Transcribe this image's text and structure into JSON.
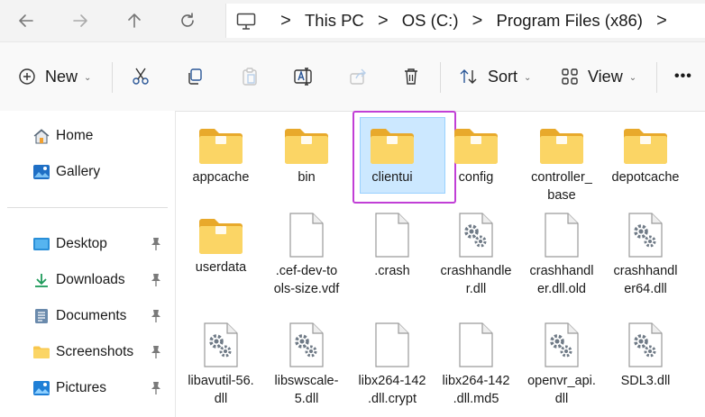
{
  "address": {
    "crumbs": [
      "This PC",
      "OS (C:)",
      "Program Files (x86)"
    ],
    "separator": ">"
  },
  "icons": {
    "back": "arrow-left-icon",
    "forward": "arrow-right-icon",
    "up": "arrow-up-icon",
    "refresh": "refresh-icon",
    "computer": "monitor-icon"
  },
  "toolbar": {
    "new_label": "New",
    "sort_label": "Sort",
    "view_label": "View",
    "more_label": "•••"
  },
  "sidebar": {
    "items": [
      {
        "label": "Home",
        "icon": "home-icon",
        "pinned": false
      },
      {
        "label": "Gallery",
        "icon": "gallery-icon",
        "pinned": false
      },
      {
        "label": "Desktop",
        "icon": "desktop-icon",
        "pinned": true
      },
      {
        "label": "Downloads",
        "icon": "download-icon",
        "pinned": true
      },
      {
        "label": "Documents",
        "icon": "documents-icon",
        "pinned": true
      },
      {
        "label": "Screenshots",
        "icon": "folder-icon",
        "pinned": true
      },
      {
        "label": "Pictures",
        "icon": "pictures-icon",
        "pinned": true
      }
    ]
  },
  "files": [
    {
      "lines": [
        "appcache"
      ],
      "type": "folder"
    },
    {
      "lines": [
        "bin"
      ],
      "type": "folder"
    },
    {
      "lines": [
        "clientui"
      ],
      "type": "folder",
      "selected": true
    },
    {
      "lines": [
        "config"
      ],
      "type": "folder"
    },
    {
      "lines": [
        "controller_",
        "base"
      ],
      "type": "folder"
    },
    {
      "lines": [
        "depotcache"
      ],
      "type": "folder"
    },
    {
      "lines": [
        "userdata"
      ],
      "type": "folder"
    },
    {
      "lines": [
        ".cef-dev-to",
        "ols-size.vdf"
      ],
      "type": "file"
    },
    {
      "lines": [
        ".crash"
      ],
      "type": "file"
    },
    {
      "lines": [
        "crashhandle",
        "r.dll"
      ],
      "type": "dll"
    },
    {
      "lines": [
        "crashhandl",
        "er.dll.old"
      ],
      "type": "file"
    },
    {
      "lines": [
        "crashhandl",
        "er64.dll"
      ],
      "type": "dll"
    },
    {
      "lines": [
        "libavutil-56.",
        "dll"
      ],
      "type": "dll"
    },
    {
      "lines": [
        "libswscale-",
        "5.dll"
      ],
      "type": "dll"
    },
    {
      "lines": [
        "libx264-142",
        ".dll.crypt"
      ],
      "type": "file"
    },
    {
      "lines": [
        "libx264-142",
        ".dll.md5"
      ],
      "type": "file"
    },
    {
      "lines": [
        "openvr_api.",
        "dll"
      ],
      "type": "dll"
    },
    {
      "lines": [
        "SDL3.dll"
      ],
      "type": "dll"
    }
  ],
  "colors": {
    "folder": "#f8c74e",
    "folder_dark": "#e8a92b",
    "selection": "#cce8ff",
    "highlight_border": "#c13fd6"
  }
}
